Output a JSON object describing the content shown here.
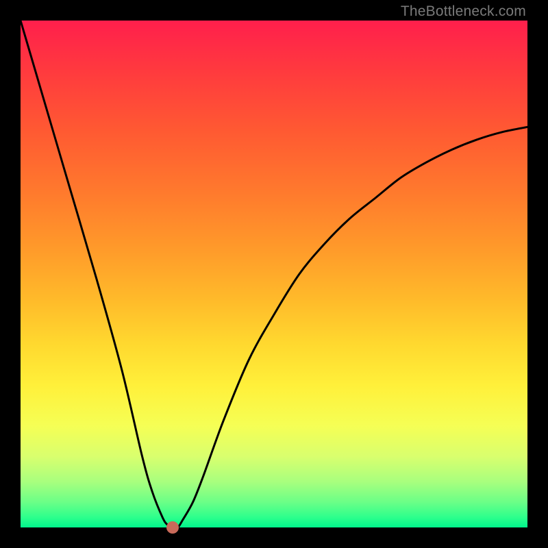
{
  "watermark": "TheBottleneck.com",
  "colors": {
    "frame": "#000000",
    "curve": "#000000",
    "dot": "#c96a5a",
    "gradient_top": "#ff1f4c",
    "gradient_bottom": "#00f58c"
  },
  "chart_data": {
    "type": "line",
    "title": "",
    "xlabel": "",
    "ylabel": "",
    "xlim": [
      0,
      100
    ],
    "ylim": [
      0,
      100
    ],
    "grid": false,
    "legend": false,
    "series": [
      {
        "name": "bottleneck-curve",
        "x": [
          0,
          5,
          10,
          15,
          20,
          24,
          26,
          28,
          29,
          30,
          31,
          32,
          34,
          36,
          40,
          45,
          50,
          55,
          60,
          65,
          70,
          75,
          80,
          85,
          90,
          95,
          100
        ],
        "values": [
          100,
          83,
          66,
          49,
          31,
          14,
          7,
          2,
          0.5,
          0,
          0,
          1.5,
          5,
          10,
          21,
          33,
          42,
          50,
          56,
          61,
          65,
          69,
          72,
          74.5,
          76.5,
          78,
          79
        ]
      }
    ],
    "marker": {
      "name": "optimum-point",
      "x": 30,
      "y": 0
    }
  }
}
